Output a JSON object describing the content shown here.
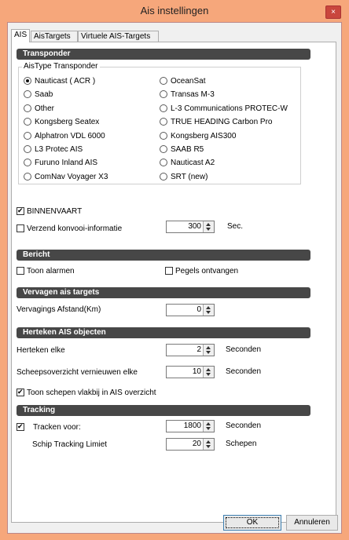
{
  "window": {
    "title": "Ais instellingen",
    "close_glyph": "×"
  },
  "tabs": [
    "AIS",
    "AisTargets",
    "Virtuele AIS-Targets"
  ],
  "transponder": {
    "section": "Transponder",
    "group_label": "AisType Transponder",
    "selected": "Nauticast ( ACR )",
    "left": [
      "Nauticast ( ACR )",
      "Saab",
      "Other",
      "Kongsberg Seatex",
      "Alphatron VDL 6000",
      "L3 Protec AIS",
      "Furuno Inland AIS",
      "ComNav Voyager X3"
    ],
    "right": [
      "OceanSat",
      "Transas M-3",
      "L-3 Communications PROTEC-W",
      "TRUE HEADING Carbon Pro",
      "Kongsberg AIS300",
      "SAAB R5",
      "Nauticast A2",
      "SRT (new)"
    ],
    "binnenvaart": {
      "label": "BINNENVAART",
      "checked": true
    },
    "konvooi": {
      "label": "Verzend konvooi-informatie",
      "checked": false,
      "value": "300",
      "unit": "Sec."
    }
  },
  "bericht": {
    "section": "Bericht",
    "toon_alarmen": {
      "label": "Toon alarmen",
      "checked": false
    },
    "pegels": {
      "label": "Pegels ontvangen",
      "checked": false
    }
  },
  "vervagen": {
    "section": "Vervagen ais targets",
    "afstand_label": "Vervagings Afstand(Km)",
    "afstand_value": "0"
  },
  "herteken": {
    "section": "Herteken AIS objecten",
    "elke_label": "Herteken elke",
    "elke_value": "2",
    "elke_unit": "Seconden",
    "overzicht_label": "Scheepsoverzicht vernieuwen elke",
    "overzicht_value": "10",
    "overzicht_unit": "Seconden",
    "toon_schepen": {
      "label": "Toon schepen vlakbij in AIS overzicht",
      "checked": true
    }
  },
  "tracking": {
    "section": "Tracking",
    "tracken": {
      "label": "Tracken voor:",
      "checked": true,
      "value": "1800",
      "unit": "Seconden"
    },
    "limiet_label": "Schip Tracking Limiet",
    "limiet_value": "20",
    "limiet_unit": "Schepen"
  },
  "buttons": {
    "ok": "OK",
    "cancel": "Annuleren"
  }
}
